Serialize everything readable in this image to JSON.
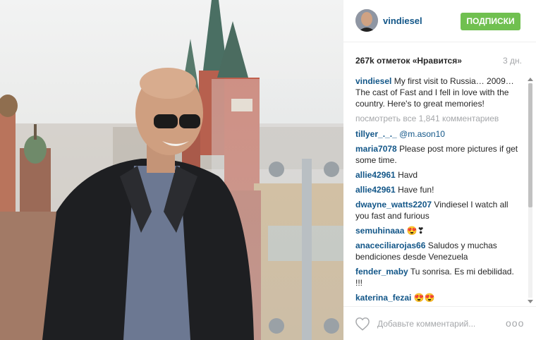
{
  "post": {
    "username": "vindiesel",
    "follow_label": "ПОДПИСКИ",
    "likes": "267k отметок «Нравится»",
    "date": "3 дн.",
    "caption_user": "vindiesel",
    "caption_line1": "My first visit to Russia… 2009… The cast of Fast and I fell in love with the country.",
    "caption_line2": "Here's to great memories!",
    "view_all": "посмотреть все 1,841 комментариев"
  },
  "comments": [
    {
      "user": "tillyer_._._",
      "text": "@m.ason10"
    },
    {
      "user": "maria7078",
      "text": "Please post more pictures if get some time."
    },
    {
      "user": "allie42961",
      "text": "Havd"
    },
    {
      "user": "allie42961",
      "text": "Have fun!"
    },
    {
      "user": "dwayne_watts2207",
      "text": "Vindiesel I watch all you fast and furious"
    },
    {
      "user": "semuhinaaa",
      "text": "😍❣"
    },
    {
      "user": "anaceciliarojas66",
      "text": "Saludos y muchas bendiciones desde Venezuela"
    },
    {
      "user": "fender_maby",
      "text": "Tu sonrisa. Es mi debilidad. !!!"
    },
    {
      "user": "katerina_fezai",
      "text": "😍😍"
    }
  ],
  "footer": {
    "comment_placeholder": "Добавьте комментарий...",
    "more_label": "ooo"
  },
  "icons": {
    "like": "heart-icon",
    "more": "more-options-icon",
    "scroll_up": "scroll-up-arrow-icon",
    "scroll_down": "scroll-down-arrow-icon"
  },
  "colors": {
    "username": "#125688",
    "follow_button": "#70c050",
    "muted": "#a5a7aa"
  }
}
